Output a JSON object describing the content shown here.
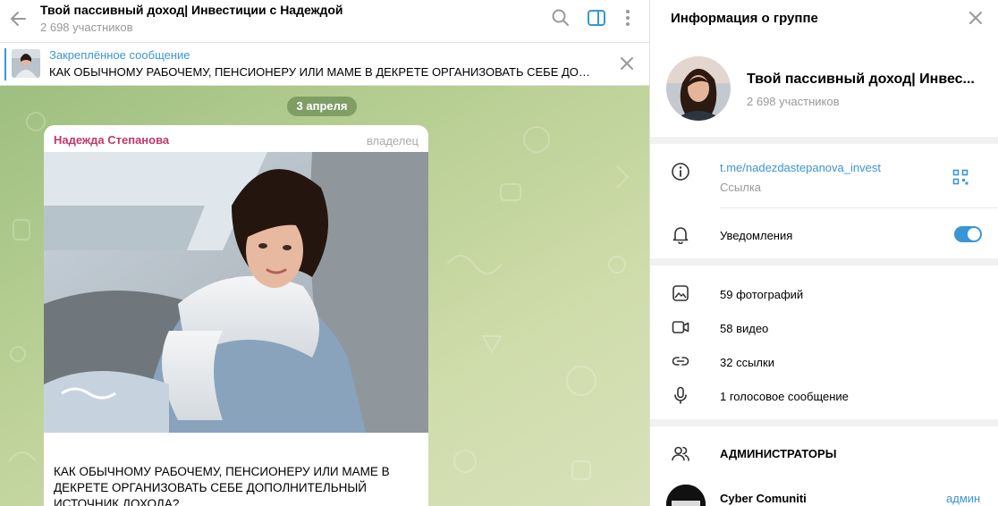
{
  "header": {
    "title": "Твой пассивный доход| Инвестиции с Надеждой",
    "subtitle": "2 698 участников"
  },
  "pinned": {
    "label": "Закреплённое сообщение",
    "text": "КАК ОБЫЧНОМУ РАБОЧЕМУ, ПЕНСИОНЕРУ ИЛИ МАМЕ В ДЕКРЕТЕ ОРГАНИЗОВАТЬ СЕБЕ ДОПОЛ..."
  },
  "chat": {
    "date": "3 апреля",
    "message": {
      "sender": "Надежда Степанова",
      "role": "владелец",
      "text": "КАК ОБЫЧНОМУ РАБОЧЕМУ, ПЕНСИОНЕРУ ИЛИ МАМЕ В ДЕКРЕТЕ ОРГАНИЗОВАТЬ СЕБЕ ДОПОЛНИТЕЛЬНЫЙ ИСТОЧНИК ДОХОДА?"
    }
  },
  "info_panel": {
    "title": "Информация о группе",
    "group_name": "Твой пассивный доход| Инвес...",
    "members": "2 698 участников",
    "link": "t.me/nadezdastepanova_invest",
    "link_label": "Ссылка",
    "notifications_label": "Уведомления",
    "notifications_on": true,
    "media": [
      {
        "label": "59 фотографий",
        "icon": "photo-icon"
      },
      {
        "label": "58 видео",
        "icon": "video-icon"
      },
      {
        "label": "32 ссылки",
        "icon": "link-icon"
      },
      {
        "label": "1 голосовое сообщение",
        "icon": "microphone-icon"
      }
    ],
    "admins_title": "АДМИНИСТРАТОРЫ",
    "admins": [
      {
        "name": "Cyber Comuniti",
        "role": "админ"
      }
    ]
  },
  "colors": {
    "accent": "#3a95d5",
    "sender": "#c0396b",
    "chat_bg": "#b8cf93"
  }
}
